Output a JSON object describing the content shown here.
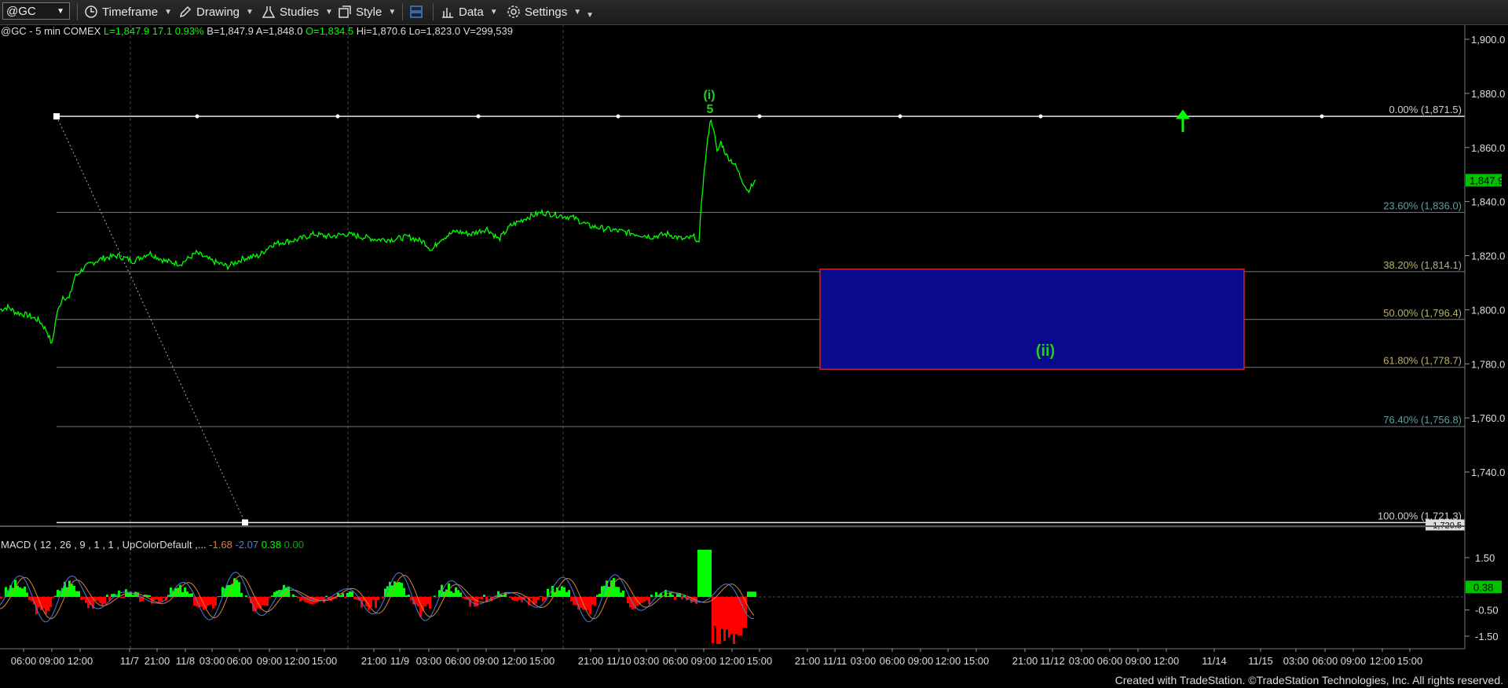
{
  "toolbar": {
    "symbol": "@GC",
    "timeframe": "Timeframe",
    "drawing": "Drawing",
    "studies": "Studies",
    "style": "Style",
    "data": "Data",
    "settings": "Settings"
  },
  "header": {
    "symbol": "@GC - 5 min",
    "exchange": "COMEX",
    "last": "L=1,847.9",
    "change": "17.1",
    "change_pct": "0.93%",
    "bid": "B=1,847.9",
    "ask": "A=1,848.0",
    "open": "O=1,834.5",
    "high": "Hi=1,870.6",
    "low": "Lo=1,823.0",
    "volume": "V=299,539"
  },
  "macd_header": {
    "label": "MACD ( 12 , 26 , 9 , 1 , 1 , UpColorDefault ,...",
    "v1": "-1.68",
    "v2": "-2.07",
    "v3": "0.38",
    "v4": "0.00"
  },
  "colors": {
    "price": "#00ff00",
    "fib_line": "#7a7a7a",
    "box_fill": "#0a0a8c",
    "box_border": "#cc2222",
    "wave_label": "#22cc22",
    "macd_up": "#00ff00",
    "macd_down": "#ff0000",
    "macd_line": "#4a7fd6",
    "signal_line": "#d9823b"
  },
  "chart_data": {
    "type": "line",
    "title": "@GC - 5 min",
    "ylim": [
      1720,
      1905
    ],
    "y_ticks": [
      "1,900.0",
      "1,880.0",
      "1,860.0",
      "1,840.0",
      "1,820.0",
      "1,800.0",
      "1,780.0",
      "1,760.0",
      "1,740.0"
    ],
    "y_tick_values": [
      1900,
      1880,
      1860,
      1840,
      1820,
      1800,
      1780,
      1760,
      1740
    ],
    "x_ticks": [
      "06:00",
      "09:00",
      "12:00",
      "11/7",
      "21:00",
      "11/8",
      "03:00",
      "06:00",
      "09:00",
      "12:00",
      "15:00",
      "21:00",
      "11/9",
      "03:00",
      "06:00",
      "09:00",
      "12:00",
      "15:00",
      "21:00",
      "11/10",
      "03:00",
      "06:00",
      "09:00",
      "12:00",
      "15:00",
      "21:00",
      "11/11",
      "03:00",
      "06:00",
      "09:00",
      "12:00",
      "15:00",
      "21:00",
      "11/12",
      "03:00",
      "06:00",
      "09:00",
      "12:00",
      "11/14",
      "11/15",
      "03:00",
      "06:00",
      "09:00",
      "12:00",
      "15:00"
    ],
    "x_tick_positions": [
      30,
      66,
      102,
      165,
      200,
      236,
      270,
      305,
      343,
      378,
      413,
      476,
      509,
      546,
      583,
      619,
      655,
      690,
      752,
      788,
      823,
      860,
      896,
      932,
      967,
      1028,
      1063,
      1099,
      1136,
      1172,
      1207,
      1243,
      1305,
      1340,
      1377,
      1413,
      1449,
      1485,
      1546,
      1605,
      1650,
      1687,
      1723,
      1760,
      1795
    ],
    "series": [
      {
        "values": [
          [
            0,
            1800
          ],
          [
            10,
            1801
          ],
          [
            20,
            1799
          ],
          [
            35,
            1798
          ],
          [
            50,
            1796
          ],
          [
            60,
            1792
          ],
          [
            66,
            1787
          ],
          [
            72,
            1798
          ],
          [
            80,
            1805
          ],
          [
            88,
            1804
          ],
          [
            95,
            1812
          ],
          [
            105,
            1815
          ],
          [
            115,
            1817
          ],
          [
            130,
            1819
          ],
          [
            150,
            1820
          ],
          [
            170,
            1818
          ],
          [
            190,
            1821
          ],
          [
            210,
            1818
          ],
          [
            230,
            1817
          ],
          [
            250,
            1821
          ],
          [
            270,
            1818
          ],
          [
            290,
            1816
          ],
          [
            310,
            1819
          ],
          [
            330,
            1820
          ],
          [
            345,
            1824
          ],
          [
            360,
            1825
          ],
          [
            380,
            1826
          ],
          [
            400,
            1828
          ],
          [
            420,
            1827
          ],
          [
            440,
            1828
          ],
          [
            460,
            1827
          ],
          [
            480,
            1826
          ],
          [
            500,
            1826
          ],
          [
            520,
            1827
          ],
          [
            540,
            1825
          ],
          [
            550,
            1822
          ],
          [
            560,
            1826
          ],
          [
            580,
            1829
          ],
          [
            600,
            1828
          ],
          [
            620,
            1830
          ],
          [
            635,
            1826
          ],
          [
            650,
            1831
          ],
          [
            670,
            1834
          ],
          [
            690,
            1836
          ],
          [
            710,
            1835
          ],
          [
            730,
            1834
          ],
          [
            750,
            1831
          ],
          [
            770,
            1830
          ],
          [
            790,
            1829
          ],
          [
            810,
            1828
          ],
          [
            830,
            1827
          ],
          [
            850,
            1828
          ],
          [
            870,
            1826
          ],
          [
            885,
            1827
          ],
          [
            890,
            1824
          ],
          [
            893,
            1840
          ],
          [
            898,
            1855
          ],
          [
            904,
            1870
          ],
          [
            908,
            1868
          ],
          [
            913,
            1858
          ],
          [
            918,
            1862
          ],
          [
            925,
            1857
          ],
          [
            935,
            1854
          ],
          [
            945,
            1848
          ],
          [
            952,
            1844
          ],
          [
            958,
            1846
          ],
          [
            962,
            1848
          ]
        ]
      }
    ],
    "fib_levels": [
      {
        "label": "0.00% (1,871.5)",
        "value": 1871.5
      },
      {
        "label": "23.60% (1,836.0)",
        "value": 1836.0
      },
      {
        "label": "38.20% (1,814.1)",
        "value": 1814.1
      },
      {
        "label": "50.00% (1,796.4)",
        "value": 1796.4
      },
      {
        "label": "61.80% (1,778.7)",
        "value": 1778.7
      },
      {
        "label": "76.40% (1,756.8)",
        "value": 1756.8
      },
      {
        "label": "100.00% (1,721.3)",
        "value": 1721.3
      }
    ],
    "last_price_label": "1,847.9",
    "last_price_value": 1847.9,
    "bottom_axis_label": "1,720.5",
    "wave_labels": [
      "(i)",
      "5",
      "(ii)"
    ],
    "target_box": {
      "top": 1815,
      "bottom": 1778
    },
    "macd": {
      "ylim": [
        -1.8,
        1.8
      ],
      "y_ticks": [
        "1.50",
        "-0.50",
        "-1.50"
      ],
      "y_tick_values": [
        1.5,
        -0.5,
        -1.5
      ],
      "last_label": "0.38"
    }
  },
  "footer": {
    "credit": "Created with TradeStation. ©TradeStation Technologies, Inc. All rights reserved."
  }
}
